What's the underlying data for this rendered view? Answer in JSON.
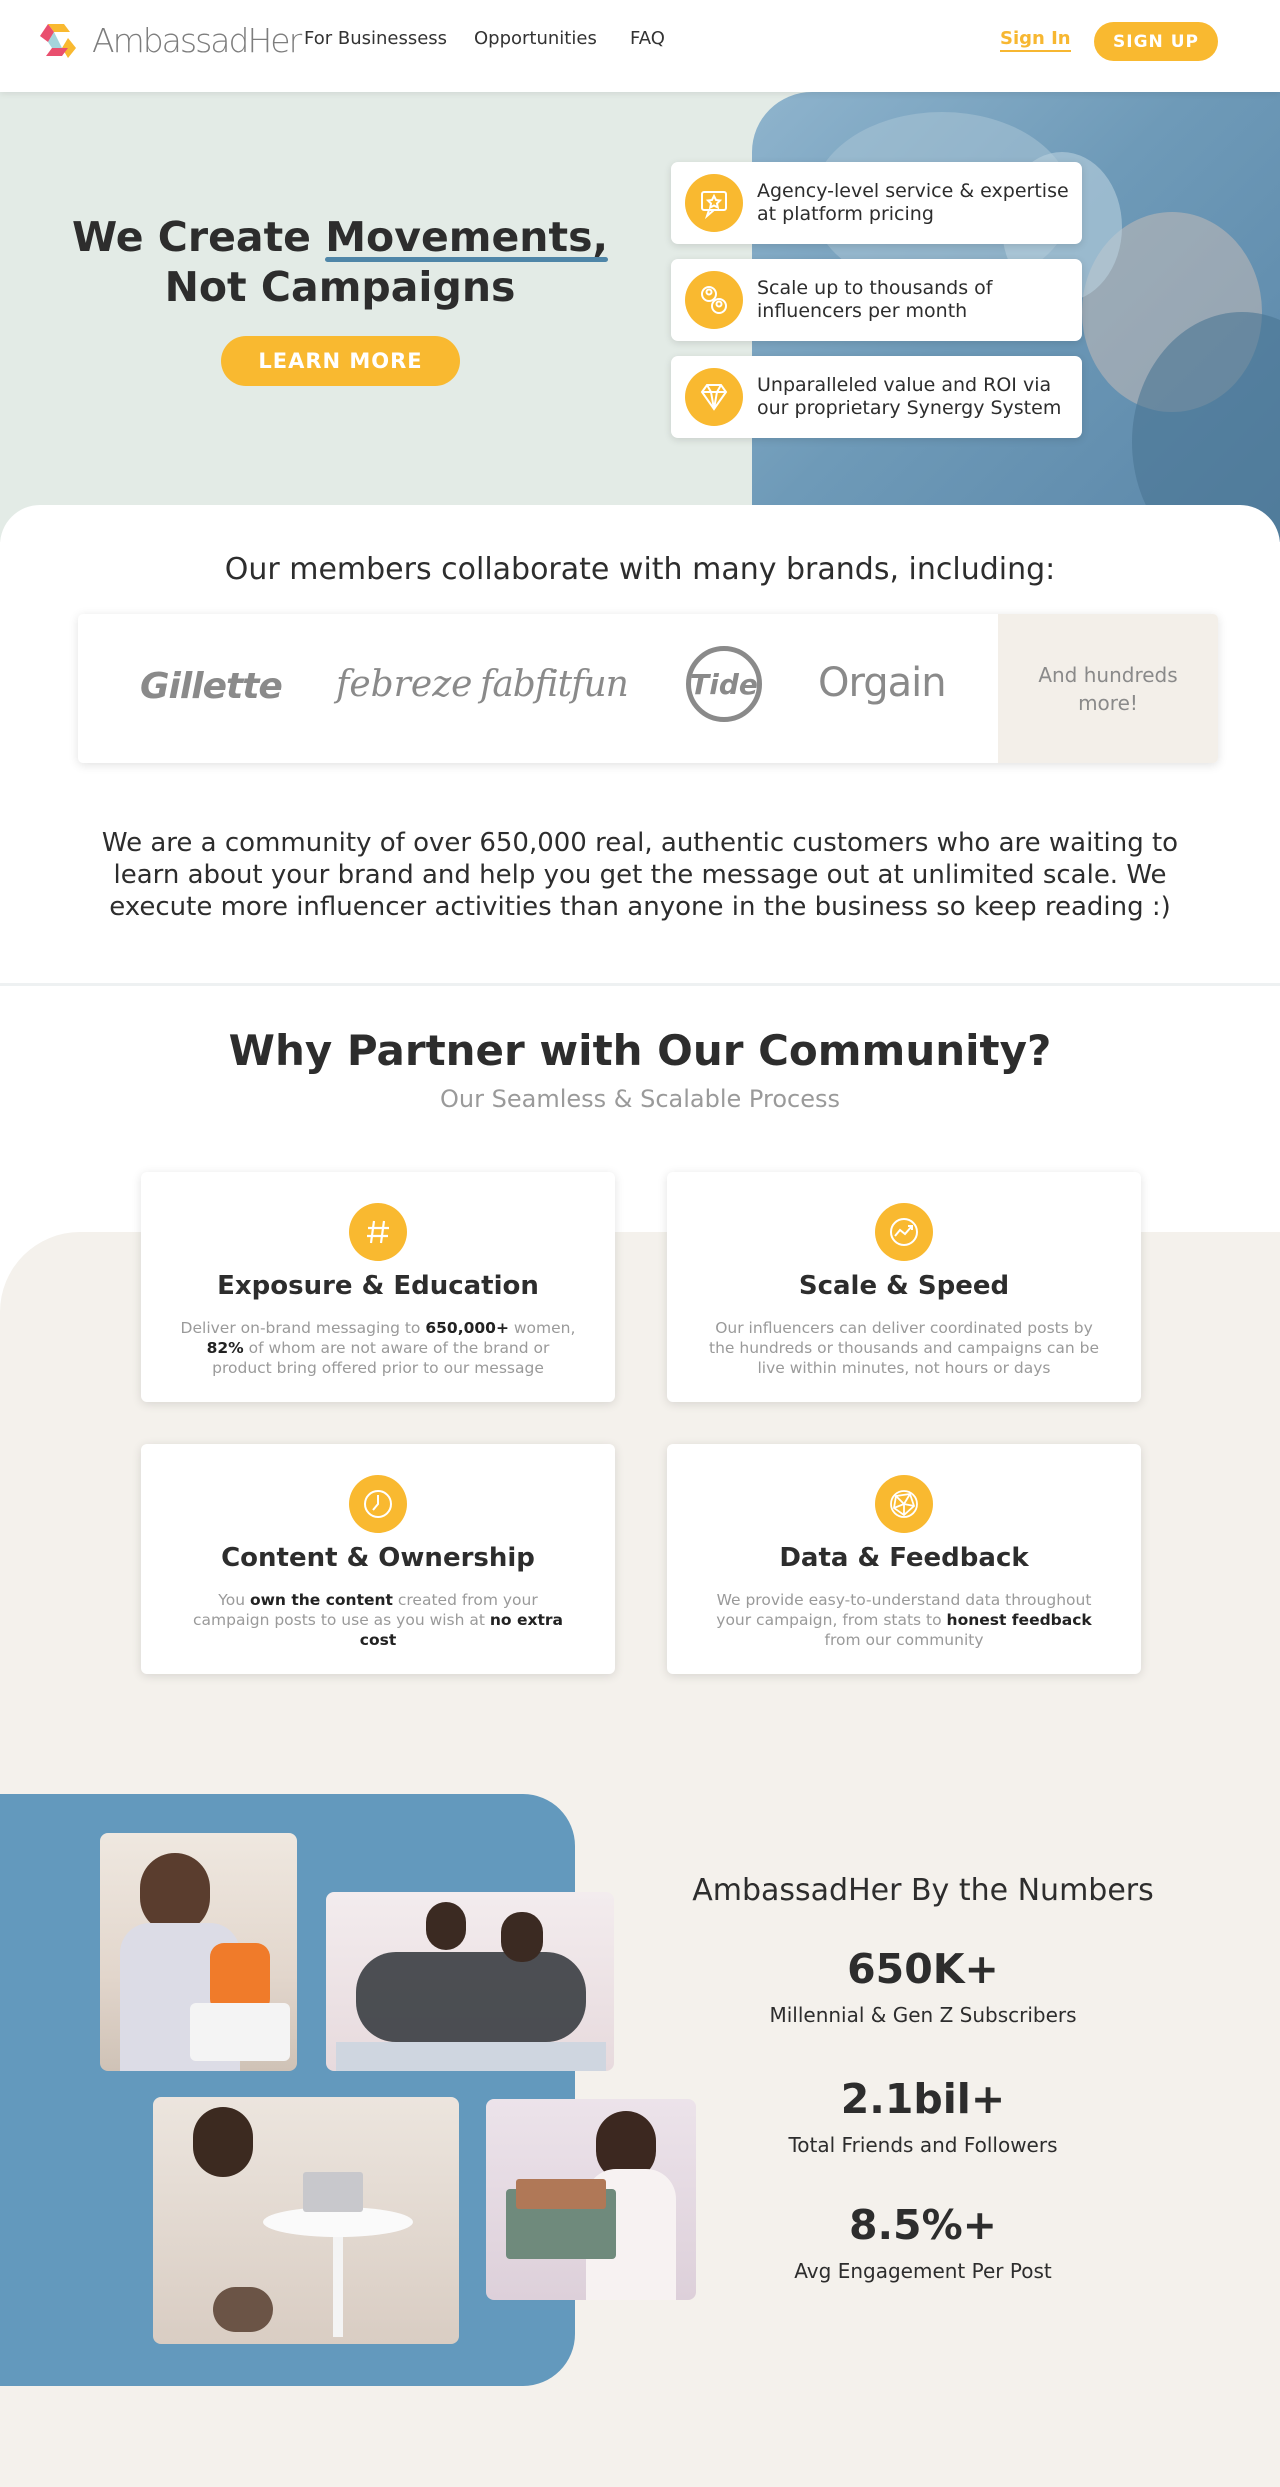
{
  "nav": {
    "logo_text": "AmbassadHer",
    "links": [
      "For Businessess",
      "Opportunities",
      "FAQ"
    ],
    "sign_in": "Sign In",
    "sign_up": "SIGN UP"
  },
  "hero": {
    "title_part1": "We Create ",
    "title_highlight": "Movements,",
    "title_line2": "Not Campaigns",
    "cta": "LEARN MORE",
    "features": [
      {
        "icon": "star-chat-icon",
        "text": "Agency-level service & expertise at platform pricing"
      },
      {
        "icon": "people-icon",
        "text": "Scale up to thousands of influencers per month"
      },
      {
        "icon": "diamond-icon",
        "text": "Unparalleled value and ROI via our proprietary Synergy System"
      }
    ]
  },
  "brands": {
    "heading": "Our members collaborate with many brands, including:",
    "logos": [
      "Gillette",
      "febreze",
      "fabfitfun",
      "Tide",
      "Orgain"
    ],
    "more": "And hundreds more!"
  },
  "community_text": "We are a community of over 650,000 real, authentic customers who are waiting to learn about your brand and help you get the message out at unlimited scale. We execute more influencer activities than anyone in the business so keep reading :)",
  "why": {
    "title": "Why Partner with Our Community?",
    "subtitle": "Our Seamless & Scalable Process",
    "cards": [
      {
        "icon": "hashtag-icon",
        "title": "Exposure & Education",
        "t1": "Deliver on-brand messaging to ",
        "b1": "650,000+",
        "t2": " women, ",
        "b2": "82%",
        "t3": " of whom are not aware of the brand or product bring offered prior to our message"
      },
      {
        "icon": "growth-chart-icon",
        "title": "Scale & Speed",
        "t1": "Our influencers can deliver coordinated posts by the hundreds or thousands and campaigns can be live within minutes, not hours or days"
      },
      {
        "icon": "clock-icon",
        "title": "Content & Ownership",
        "t1": "You ",
        "b1": "own the content",
        "t2": " created from your campaign posts to use as you wish at ",
        "b2": "no extra cost"
      },
      {
        "icon": "network-globe-icon",
        "title": "Data & Feedback",
        "t1": "We provide easy-to-understand data throughout your campaign, from stats to ",
        "b1": "honest feedback",
        "t2": " from our community"
      }
    ]
  },
  "numbers": {
    "title": "AmbassadHer By the Numbers",
    "stats": [
      {
        "value": "650K+",
        "label": "Millennial & Gen Z Subscribers"
      },
      {
        "value": "2.1bil+",
        "label": "Total Friends and Followers"
      },
      {
        "value": "8.5%+",
        "label": "Avg Engagement Per Post"
      }
    ]
  },
  "colors": {
    "accent": "#f9b930",
    "blue": "#6399bd",
    "cream": "#f4f1ec",
    "hero_bg": "#e3ebe6"
  }
}
